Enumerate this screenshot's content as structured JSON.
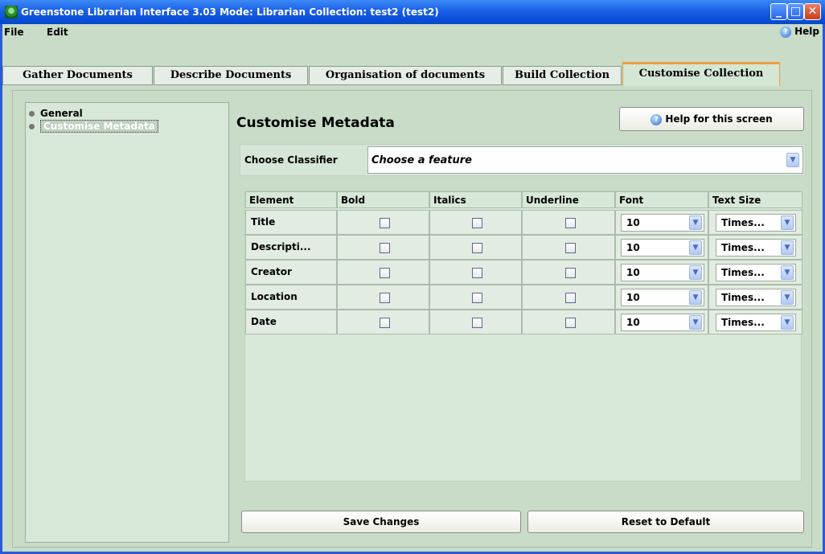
{
  "window": {
    "title": "Greenstone Librarian Interface 3.03  Mode: Librarian  Collection: test2 (test2)"
  },
  "menu": {
    "file": "File",
    "edit": "Edit",
    "help": "Help"
  },
  "tabs": [
    {
      "label": "Gather Documents"
    },
    {
      "label": "Describe Documents"
    },
    {
      "label": "Organisation of documents"
    },
    {
      "label": "Build Collection"
    },
    {
      "label": "Customise Collection"
    }
  ],
  "sidebar": {
    "items": [
      {
        "label": "General"
      },
      {
        "label": "Customise Metadata"
      }
    ]
  },
  "main": {
    "title": "Customise Metadata",
    "help_button": "Help for this screen",
    "classifier_label": "Choose Classifier",
    "classifier_value": "Choose a feature",
    "columns": [
      "Element",
      "Bold",
      "Italics",
      "Underline",
      "Font",
      "Text Size"
    ],
    "rows": [
      {
        "element": "Title",
        "font": "10",
        "size": "Times..."
      },
      {
        "element": "Descripti...",
        "font": "10",
        "size": "Times..."
      },
      {
        "element": "Creator",
        "font": "10",
        "size": "Times..."
      },
      {
        "element": "Location",
        "font": "10",
        "size": "Times..."
      },
      {
        "element": "Date",
        "font": "10",
        "size": "Times..."
      }
    ],
    "save_button": "Save Changes",
    "reset_button": "Reset to Default"
  },
  "icons": {
    "app": "greenstone-app-icon",
    "help": "help-circle-icon",
    "dropdown": "chevron-down-icon"
  }
}
